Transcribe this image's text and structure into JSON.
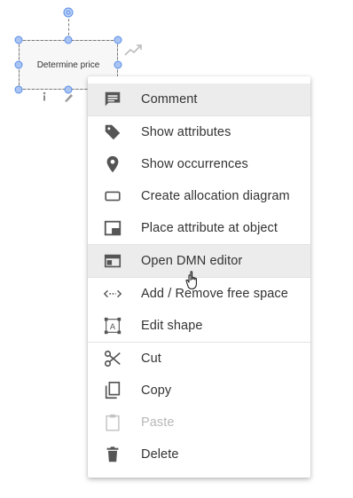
{
  "shape": {
    "label": "Determine price"
  },
  "menu": {
    "items": [
      {
        "label": "Comment",
        "icon": "comment-icon"
      },
      {
        "label": "Show attributes",
        "icon": "tag-icon"
      },
      {
        "label": "Show occurrences",
        "icon": "location-pin-icon"
      },
      {
        "label": "Create allocation diagram",
        "icon": "rectangle-icon"
      },
      {
        "label": "Place attribute at object",
        "icon": "place-attribute-icon"
      },
      {
        "label": "Open DMN editor",
        "icon": "dmn-editor-icon"
      },
      {
        "label": "Add / Remove free space",
        "icon": "free-space-icon"
      },
      {
        "label": "Edit shape",
        "icon": "edit-shape-icon"
      },
      {
        "label": "Cut",
        "icon": "scissors-icon"
      },
      {
        "label": "Copy",
        "icon": "copy-icon"
      },
      {
        "label": "Paste",
        "icon": "clipboard-icon",
        "disabled": true
      },
      {
        "label": "Delete",
        "icon": "trash-icon"
      }
    ]
  },
  "colors": {
    "icon": "#555555",
    "icon_disabled": "#c4c4c4",
    "highlight": "#ececec",
    "handle": "#5a8ee8"
  }
}
